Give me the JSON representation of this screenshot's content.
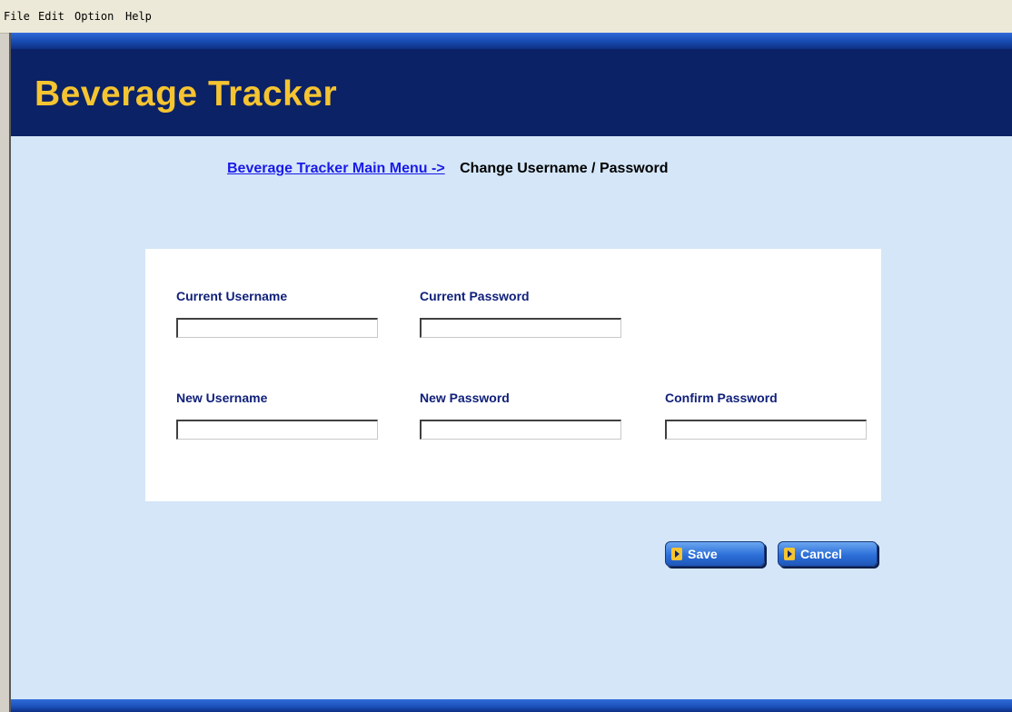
{
  "menu": {
    "items": [
      "File",
      "Edit",
      "Option",
      "Help"
    ]
  },
  "header": {
    "title": "Beverage Tracker"
  },
  "breadcrumb": {
    "link_label": "Beverage Tracker Main Menu ->",
    "current": "Change Username / Password"
  },
  "form": {
    "current_username_label": "Current Username",
    "current_username_value": "",
    "current_password_label": "Current Password",
    "current_password_value": "",
    "new_username_label": "New Username",
    "new_username_value": "",
    "new_password_label": "New Password",
    "new_password_value": "",
    "confirm_password_label": "Confirm Password",
    "confirm_password_value": ""
  },
  "actions": {
    "save_label": "Save",
    "cancel_label": "Cancel"
  },
  "colors": {
    "banner": "#0c2266",
    "title": "#f5c431",
    "content_background": "#d4e6f8",
    "label": "#10207a",
    "link": "#1a1ae8",
    "button": "#2c6fd8"
  }
}
